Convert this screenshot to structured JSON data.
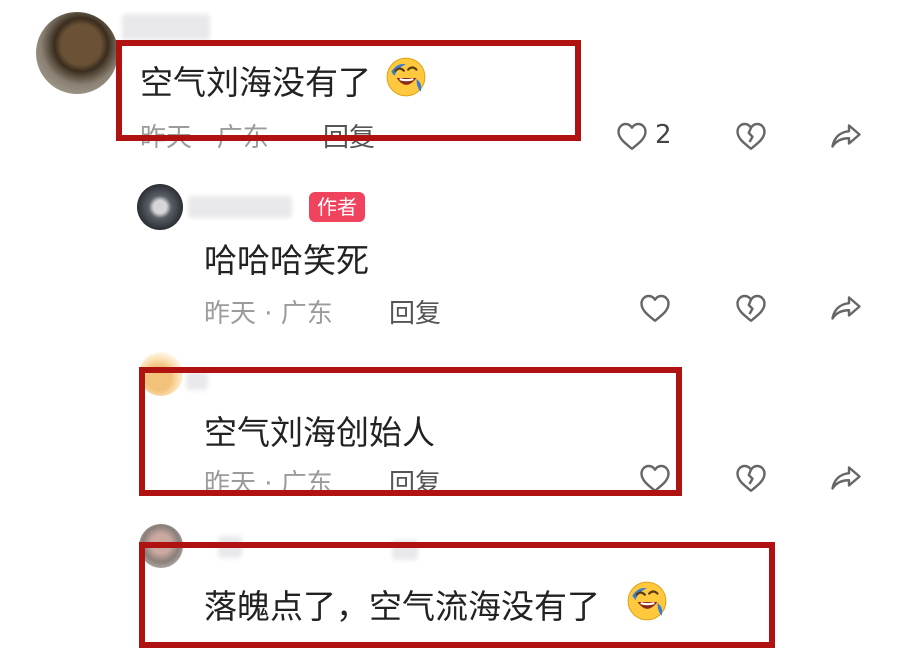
{
  "comments": [
    {
      "text": "空气刘海没有了",
      "meta": "昨天 · 广东",
      "reply": "回复",
      "likes": "2",
      "emoji": "laughing-crying-emoji"
    },
    {
      "badge": "作者",
      "text": "哈哈哈笑死",
      "meta": "昨天 · 广东",
      "reply": "回复"
    },
    {
      "text": "空气刘海创始人",
      "meta": "昨天 · 广东",
      "reply": "回复"
    },
    {
      "text": "落魄点了，空气流海没有了",
      "emoji": "laughing-crying-emoji"
    }
  ],
  "colors": {
    "highlight_box": "#b01212",
    "author_badge": "#f0435d",
    "meta_text": "#9b9b9b"
  },
  "icons": [
    "heart-icon",
    "broken-heart-icon",
    "share-icon"
  ]
}
